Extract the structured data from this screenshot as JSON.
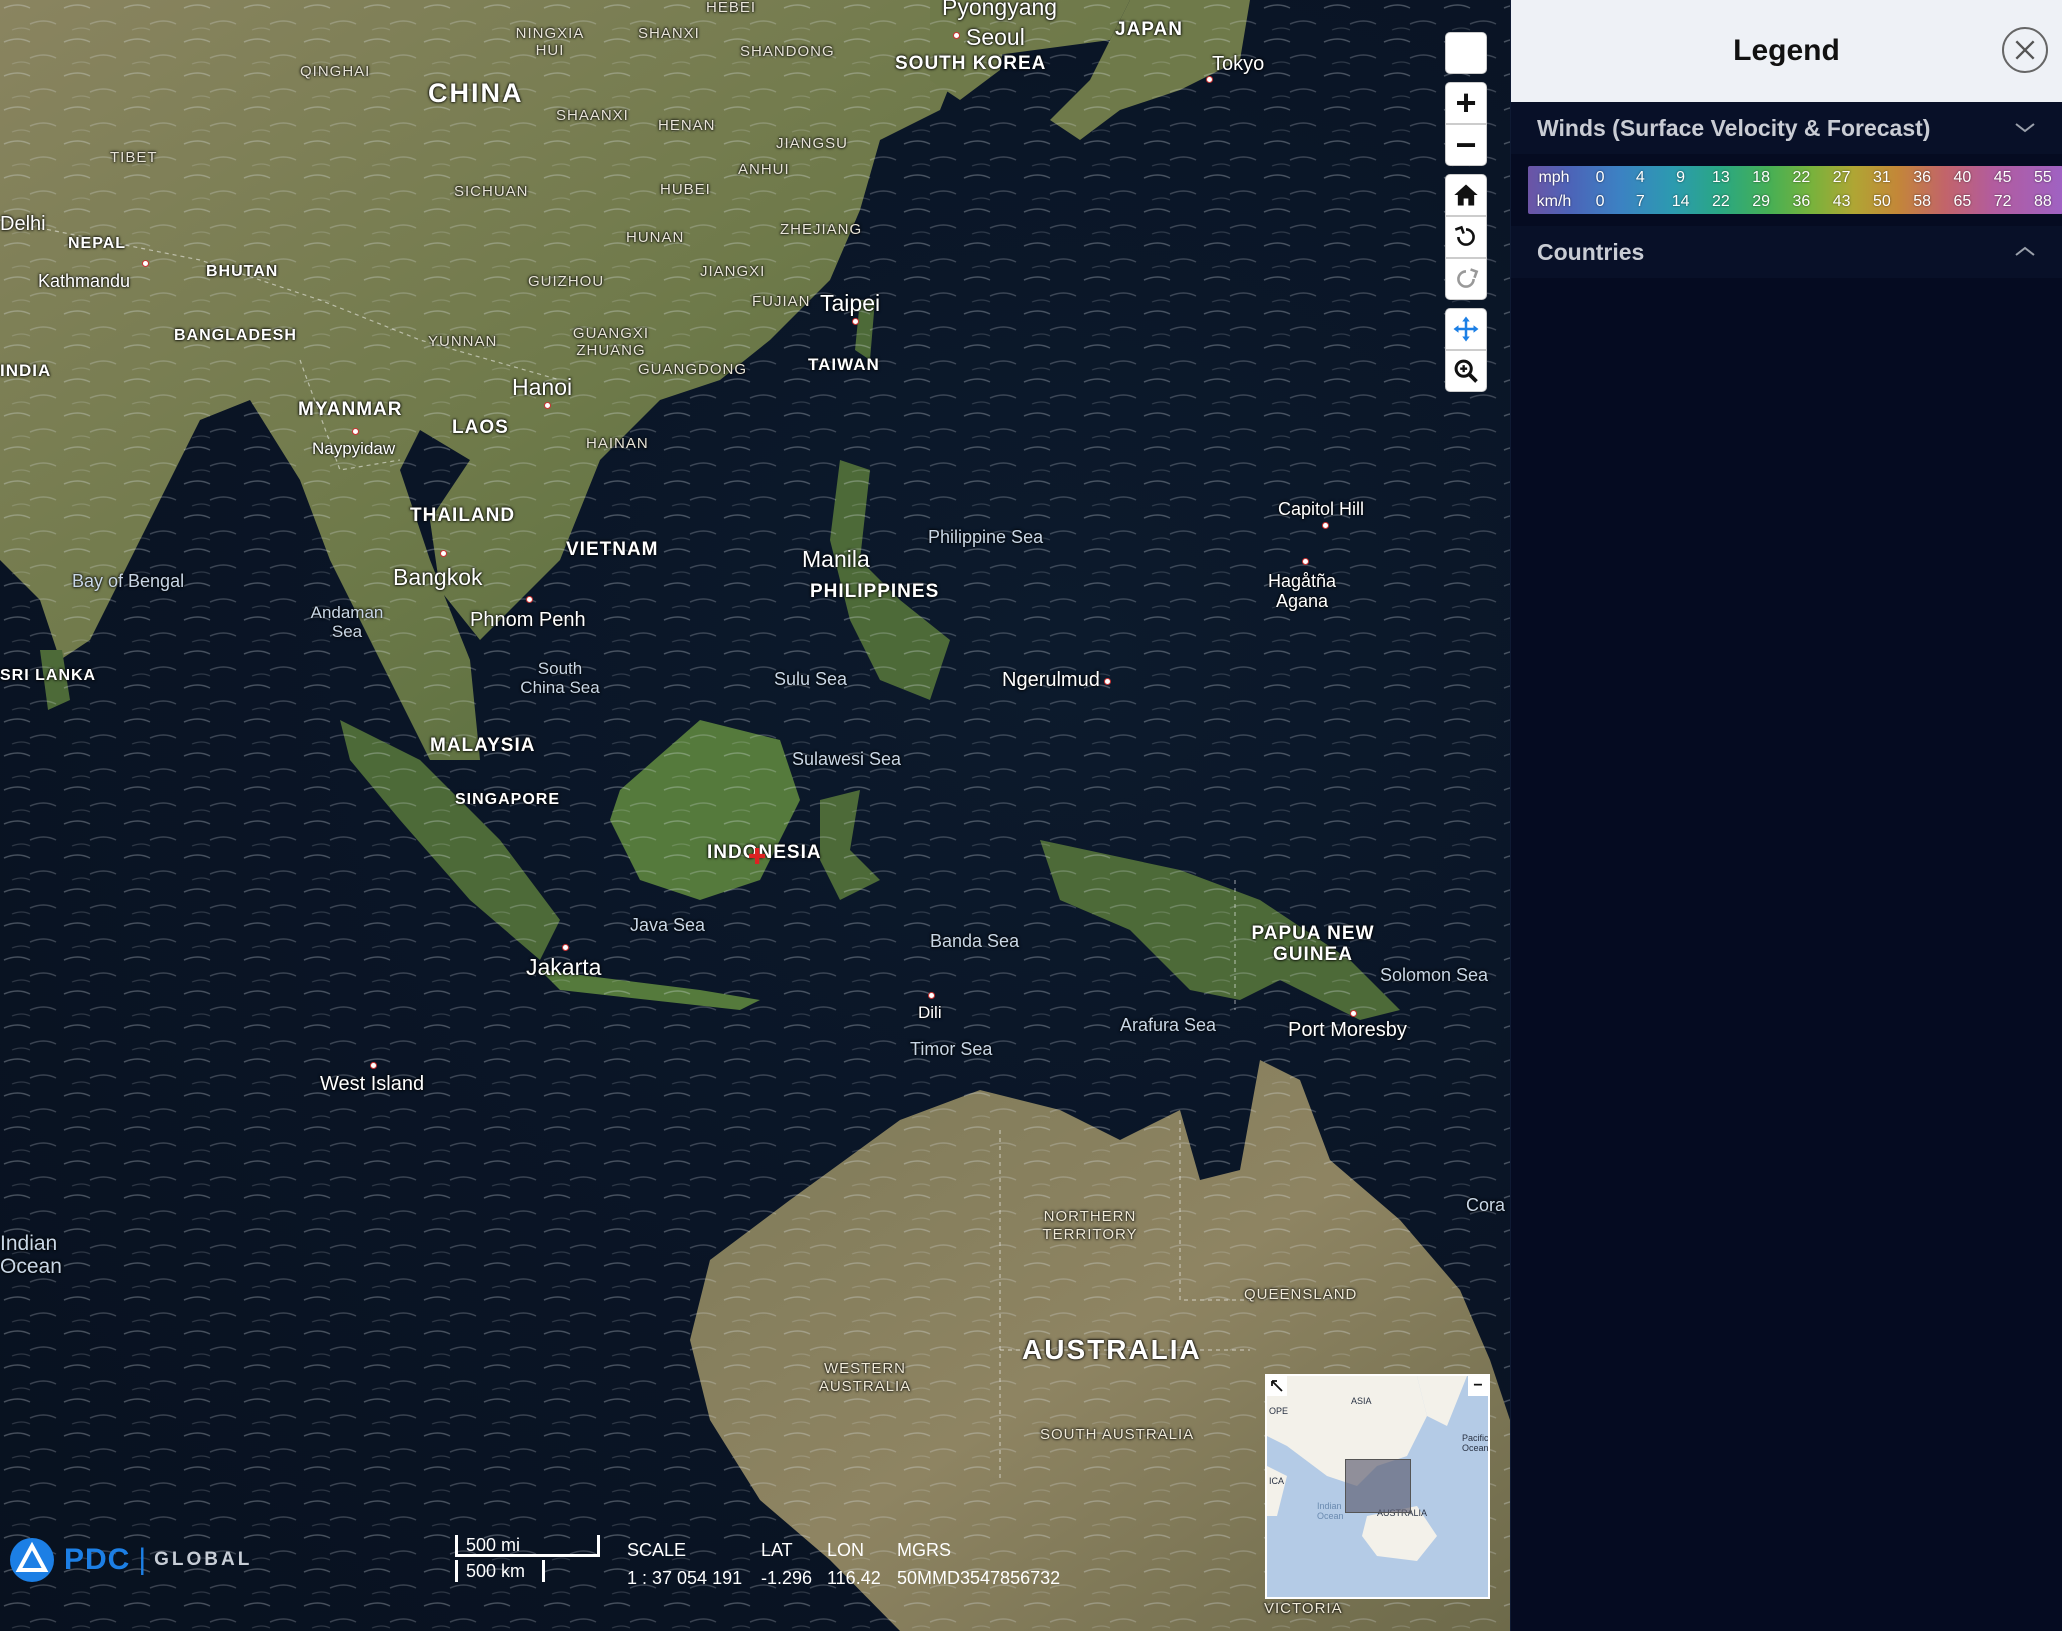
{
  "map": {
    "labels": {
      "countries": [
        "CHINA",
        "JAPAN",
        "SOUTH KOREA",
        "NEPAL",
        "BHUTAN",
        "BANGLADESH",
        "INDIA",
        "MYANMAR",
        "LAOS",
        "THAILAND",
        "VIETNAM",
        "TAIWAN",
        "PHILIPPINES",
        "MALAYSIA",
        "SINGAPORE",
        "INDONESIA",
        "SRI LANKA",
        "PAPUA NEW GUINEA",
        "AUSTRALIA"
      ],
      "regions": [
        "NINGXIA HUI",
        "SHANXI",
        "SHANDONG",
        "HEBEI",
        "QINGHAI",
        "SHAANXI",
        "HENAN",
        "JIANGSU",
        "ANHUI",
        "TIBET",
        "SICHUAN",
        "HUBEI",
        "HUNAN",
        "ZHEJIANG",
        "JIANGXI",
        "GUIZHOU",
        "FUJIAN",
        "YUNNAN",
        "GUANGXI ZHUANG",
        "GUANGDONG",
        "HAINAN"
      ],
      "states": [
        "NORTHERN TERRITORY",
        "QUEENSLAND",
        "WESTERN AUSTRALIA",
        "SOUTH AUSTRALIA",
        "VICTORIA"
      ],
      "cities": [
        "Pyongyang",
        "Seoul",
        "Tokyo",
        "Delhi",
        "Kathmandu",
        "Taipei",
        "Hanoi",
        "Naypyidaw",
        "Bangkok",
        "Phnom Penh",
        "Manila",
        "Capitol Hill",
        "Hagåtña Agana",
        "Ngerulmud",
        "Jakarta",
        "Dili",
        "Port Moresby",
        "West Island"
      ],
      "seas": [
        "Bay of Bengal",
        "Andaman Sea",
        "South China Sea",
        "Sulu Sea",
        "Philippine Sea",
        "Sulawesi Sea",
        "Java Sea",
        "Banda Sea",
        "Arafura Sea",
        "Timor Sea",
        "Solomon Sea",
        "Indian Ocean",
        "Cora"
      ]
    },
    "toolbar": {
      "zoom_in": "+",
      "zoom_out": "−"
    },
    "scale_bar": {
      "imperial": "500 mi",
      "metric": "500 km"
    },
    "readout": {
      "headers": [
        "SCALE",
        "LAT",
        "LON",
        "MGRS"
      ],
      "values": [
        "1 : 37 054 191",
        "-1.296",
        "116.42",
        "50MMD3547856732"
      ]
    },
    "logo": {
      "brand": "PDC",
      "suffix": "GLOBAL"
    },
    "overview": {
      "labels": [
        "ASIA",
        "Pacific Ocean",
        "Indian Ocean",
        "AUSTRALIA",
        "OPE",
        "ICA"
      ]
    }
  },
  "legend": {
    "title": "Legend",
    "sections": [
      {
        "title": "Winds (Surface Velocity & Forecast)",
        "expanded": true,
        "scale": {
          "mph_label": "mph",
          "kmh_label": "km/h",
          "mph": [
            "0",
            "4",
            "9",
            "13",
            "18",
            "22",
            "27",
            "31",
            "36",
            "40",
            "45",
            "55"
          ],
          "kmh": [
            "0",
            "7",
            "14",
            "22",
            "29",
            "36",
            "43",
            "50",
            "58",
            "65",
            "72",
            "88"
          ]
        }
      },
      {
        "title": "Countries",
        "expanded": false
      }
    ]
  },
  "colors": {
    "accent": "#1c7fe5",
    "panel_bg": "#050b21",
    "header_bg": "#eef1f6"
  }
}
